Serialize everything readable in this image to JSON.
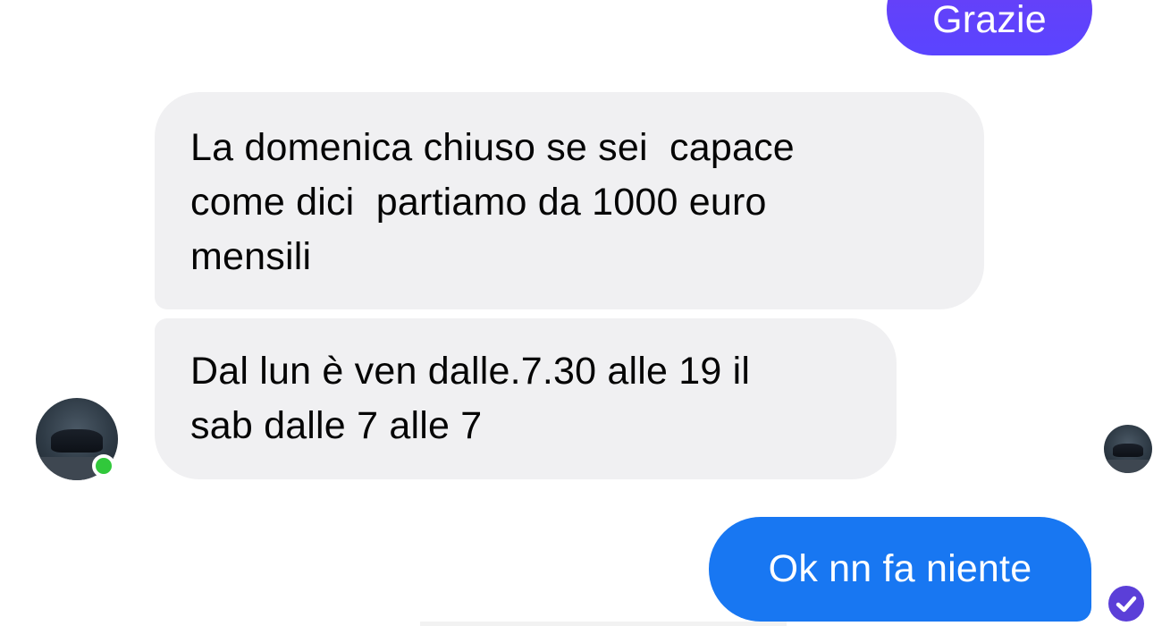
{
  "conversation": {
    "messages": [
      {
        "direction": "outgoing",
        "text": "Grazie"
      },
      {
        "direction": "incoming",
        "text": "La domenica chiuso se sei  capace\ncome dici  partiamo da 1000 euro\nmensili"
      },
      {
        "direction": "incoming",
        "text": "Dal lun è ven dalle.7.30 alle 19 il\nsab dalle 7 alle 7"
      },
      {
        "direction": "outgoing",
        "text": "Ok nn fa niente"
      }
    ],
    "contact": {
      "online": true,
      "avatar_icon": "car-avatar-icon"
    },
    "read_receipt": {
      "avatar_icon": "car-avatar-icon"
    },
    "sent_status_icon": "check-circle-icon"
  },
  "colors": {
    "outgoing_first": "#5a44ff",
    "outgoing_last": "#1877f2",
    "incoming_bg": "#f0f0f2",
    "online_dot": "#31c83b",
    "sent_icon": "#5b3fd8"
  }
}
